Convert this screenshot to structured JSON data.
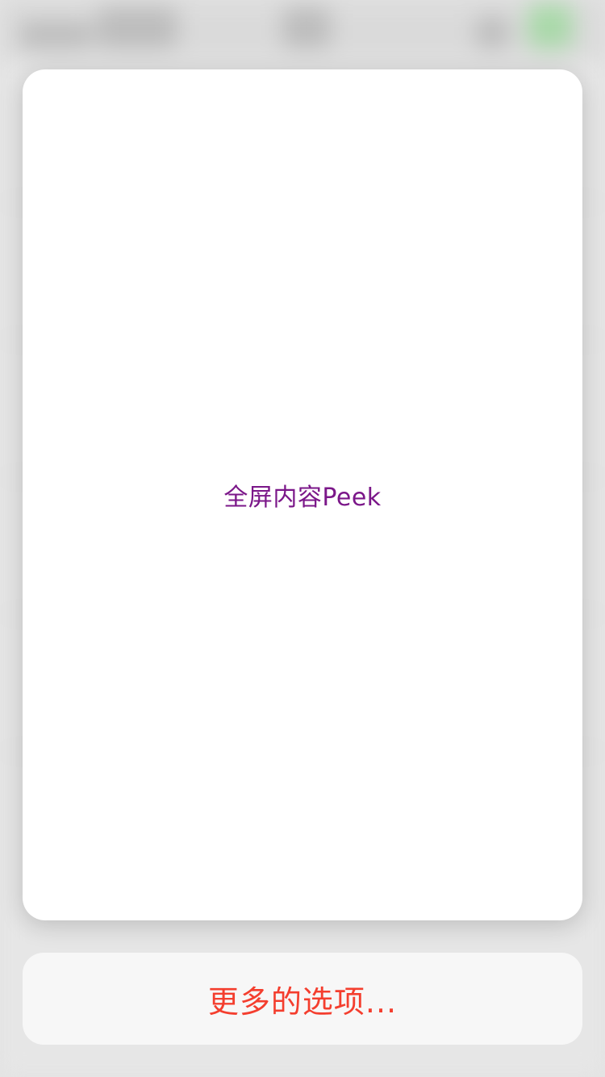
{
  "peek": {
    "label": "全屏内容Peek",
    "label_color": "#7b1789"
  },
  "action": {
    "more_options_label": "更多的选项...",
    "label_color": "#f43e2e"
  },
  "background": {
    "accent_green": "#a9d9a9"
  }
}
